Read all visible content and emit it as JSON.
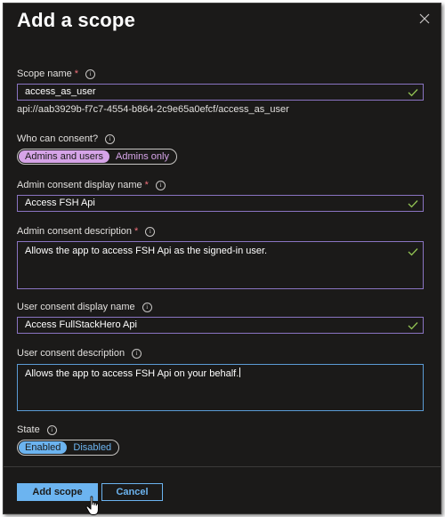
{
  "dialog": {
    "title": "Add a scope",
    "close_icon": "close-icon"
  },
  "scope_name": {
    "label": "Scope name",
    "required_mark": "*",
    "value": "access_as_user",
    "uri": "api://aab3929b-f7c7-4554-b864-2c9e65a0efcf/access_as_user"
  },
  "who_can_consent": {
    "label": "Who can consent?",
    "options": [
      "Admins and users",
      "Admins only"
    ],
    "selected": "Admins and users"
  },
  "admin_display": {
    "label": "Admin consent display name",
    "required_mark": "*",
    "value": "Access FSH Api"
  },
  "admin_description": {
    "label": "Admin consent description",
    "required_mark": "*",
    "value": "Allows the app to access FSH Api as the signed-in user."
  },
  "user_display": {
    "label": "User consent display name",
    "value": "Access FullStackHero Api"
  },
  "user_description": {
    "label": "User consent description",
    "value": "Allows the app to access FSH Api on your behalf."
  },
  "state": {
    "label": "State",
    "options": [
      "Enabled",
      "Disabled"
    ],
    "selected": "Enabled"
  },
  "footer": {
    "add_label": "Add scope",
    "cancel_label": "Cancel"
  },
  "colors": {
    "panel_bg": "#1b1a19",
    "field_border": "#8a74c2",
    "accent_blue": "#6cb4f0",
    "accent_purple": "#d6a4e8",
    "valid_check": "#92c353",
    "required": "#f1707b"
  }
}
